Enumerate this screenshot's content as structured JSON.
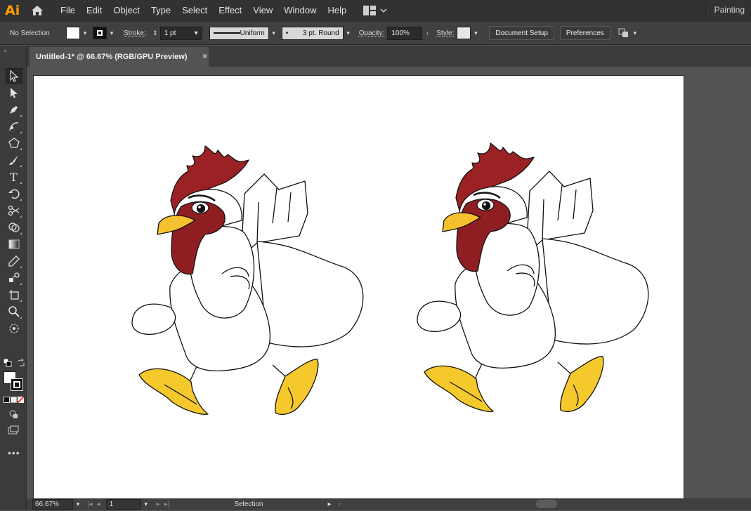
{
  "app": {
    "logo": "Ai",
    "workspace": "Painting"
  },
  "menu": [
    "File",
    "Edit",
    "Object",
    "Type",
    "Select",
    "Effect",
    "View",
    "Window",
    "Help"
  ],
  "control": {
    "selection": "No Selection",
    "stroke_label": "Stroke:",
    "stroke_weight": "1 pt",
    "profile": "Uniform",
    "brush": "3 pt. Round",
    "opacity_label": "Opacity:",
    "opacity": "100%",
    "style_label": "Style:",
    "document_setup": "Document Setup",
    "preferences": "Preferences"
  },
  "tab": {
    "title": "Untitled-1* @ 66.67% (RGB/GPU Preview)",
    "close": "×"
  },
  "tools": [
    "selection-tool",
    "direct-selection-tool",
    "pen-tool",
    "curvature-tool",
    "shape-tool",
    "paintbrush-tool",
    "type-tool",
    "rotate-tool",
    "scissors-tool",
    "shape-builder-tool",
    "gradient-tool",
    "eyedropper-tool",
    "blend-tool",
    "artboard-tool",
    "zoom-tool",
    "symbol-sprayer-tool"
  ],
  "colors": {
    "comb": "#9a2124",
    "face": "#8f1e22",
    "beak": "#f6c12e",
    "feet": "#f5c82c",
    "body": "#ffffff",
    "outline": "#111111",
    "accent": "#ff9a00"
  },
  "status": {
    "zoom": "66.67%",
    "page": "1",
    "tool": "Selection"
  }
}
